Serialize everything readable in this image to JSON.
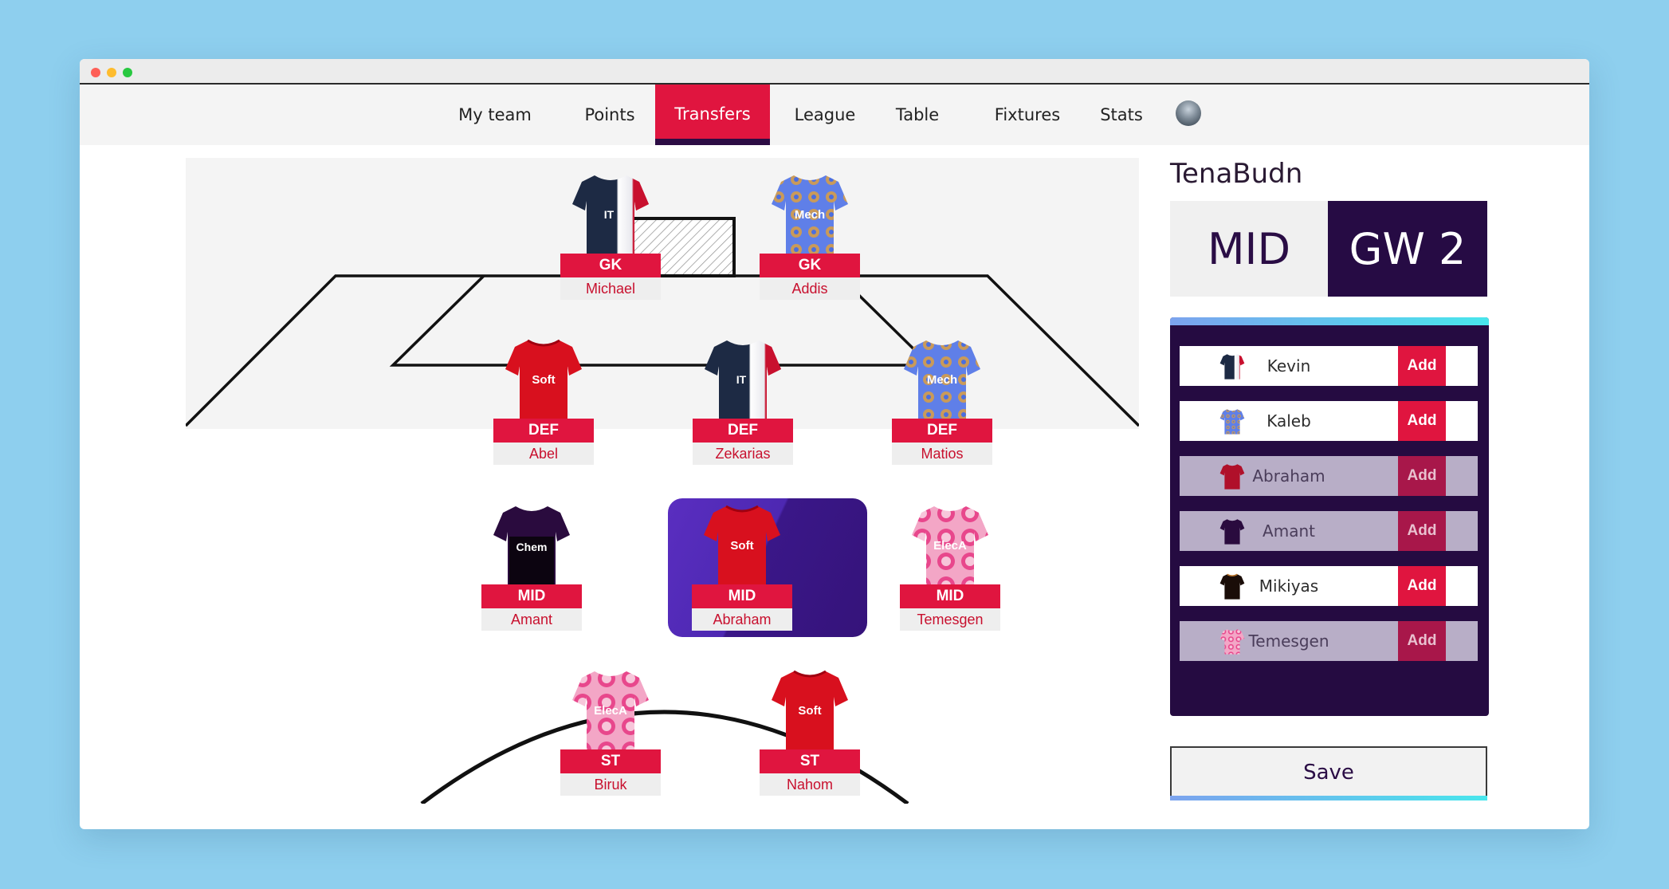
{
  "nav": {
    "items": [
      "My team",
      "Points",
      "Transfers",
      "League",
      "Table",
      "Fixtures",
      "Stats"
    ],
    "active": "Transfers"
  },
  "pitch": {
    "players": [
      {
        "position": "GK",
        "name": "Michael",
        "kit": "IT"
      },
      {
        "position": "GK",
        "name": "Addis",
        "kit": "Mech"
      },
      {
        "position": "DEF",
        "name": "Abel",
        "kit": "Soft"
      },
      {
        "position": "DEF",
        "name": "Zekarias",
        "kit": "IT"
      },
      {
        "position": "DEF",
        "name": "Matios",
        "kit": "Mech"
      },
      {
        "position": "MID",
        "name": "Amant",
        "kit": "Chem"
      },
      {
        "position": "MID",
        "name": "Abraham",
        "kit": "Soft",
        "selected": true
      },
      {
        "position": "MID",
        "name": "Temesgen",
        "kit": "ElecA"
      },
      {
        "position": "ST",
        "name": "Biruk",
        "kit": "ElecA"
      },
      {
        "position": "ST",
        "name": "Nahom",
        "kit": "Soft"
      }
    ]
  },
  "sidebar": {
    "team_name": "TenaBudn",
    "selected_position": "MID",
    "gameweek": "GW 2",
    "candidates": [
      {
        "name": "Kevin",
        "kit": "IT",
        "add_label": "Add",
        "disabled": false
      },
      {
        "name": "Kaleb",
        "kit": "Mech",
        "add_label": "Add",
        "disabled": false
      },
      {
        "name": "Abraham",
        "kit": "Soft",
        "add_label": "Add",
        "disabled": true
      },
      {
        "name": "Amant",
        "kit": "Chem",
        "add_label": "Add",
        "disabled": true
      },
      {
        "name": "Mikiyas",
        "kit": "Black",
        "add_label": "Add",
        "disabled": false
      },
      {
        "name": "Temesgen",
        "kit": "ElecA",
        "add_label": "Add",
        "disabled": true
      }
    ],
    "save_label": "Save"
  },
  "colors": {
    "accent": "#e0153f",
    "dark_purple": "#260b44",
    "background": "#8ecfee"
  }
}
